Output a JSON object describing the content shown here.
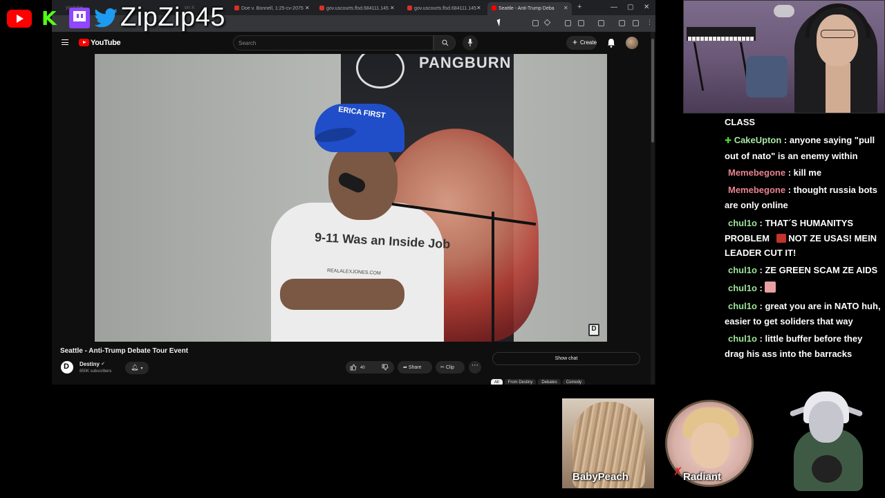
{
  "overlay": {
    "handle": "ZipZip45",
    "icons": [
      "youtube-icon",
      "kick-icon",
      "twitch-icon",
      "twitter-icon"
    ],
    "colors": {
      "youtube": "#ff0000",
      "kick": "#53fc18",
      "twitch": "#9146ff",
      "twitter": "#1d9bf0"
    }
  },
  "browser": {
    "tabs": [
      {
        "label": "Doe v. Bonnell, 1:25-cv-2075",
        "fav_color": "#d93025"
      },
      {
        "label": "gov.uscourts.flsd.684111.145",
        "fav_color": "#d93025"
      },
      {
        "label": "gov.uscourts.flsd.684111.145",
        "fav_color": "#d93025"
      },
      {
        "label": "Seattle - Anti-Trump Deba",
        "fav_color": "#ff0000",
        "active": true
      }
    ],
    "faded_tab_text": [
      "youtube",
      "on X"
    ]
  },
  "youtube": {
    "wordmark": "YouTube",
    "search_placeholder": "Search",
    "create_label": "Create",
    "video": {
      "title": "Seattle - Anti-Trump Debate Tour Event",
      "banner_text": "PANGBURN",
      "cap_text": "ERICA FIRST",
      "shirt_text": "9-11 Was an Inside Job",
      "shirt_url": "REALALEXJONES.COM"
    },
    "channel": {
      "name": "Destiny",
      "verified": "✔",
      "subscribers": "850K subscribers"
    },
    "actions": {
      "like_count": "40",
      "share_label": "Share",
      "clip_label": "Clip",
      "more": "⋯"
    },
    "show_chat": "Show chat",
    "chips": [
      "All",
      "From Destiny",
      "Debates",
      "Comedy"
    ]
  },
  "chat": {
    "messages": [
      {
        "user": "",
        "text": "CLASS",
        "user_color": "#ffffff"
      },
      {
        "user": "CakeUpton",
        "text": " : anyone saying \"pull out of nato\" is an enemy within",
        "user_color": "#a8e6a3",
        "badge": "✚"
      },
      {
        "user": "Memebegone",
        "text": " : kill me",
        "user_color": "#e8838e"
      },
      {
        "user": "Memebegone",
        "text": " : thought russia bots are only online",
        "user_color": "#e8838e"
      },
      {
        "user": "chul1o",
        "text": " : THAT´S HUMANITYS PROBLEM",
        "text_after_emote": " NOT ZE USAS! MEIN LEADER CUT IT!",
        "user_color": "#9de59a",
        "emote": "angry-face-emote"
      },
      {
        "user": "chul1o",
        "text": " : ZE GREEN SCAM ZE AIDS",
        "user_color": "#9de59a"
      },
      {
        "user": "chul1o",
        "text": " : ",
        "user_color": "#9de59a",
        "emote": "pink-emote"
      },
      {
        "user": "chul1o",
        "text": " : great you are in NATO huh, easier to get soliders that way",
        "user_color": "#9de59a"
      },
      {
        "user": "chul1o",
        "text": " : little buffer before they drag his ass into the barracks",
        "user_color": "#9de59a"
      }
    ]
  },
  "avatars": {
    "left_name": "BabyPeach",
    "center_name": "Radiant"
  }
}
